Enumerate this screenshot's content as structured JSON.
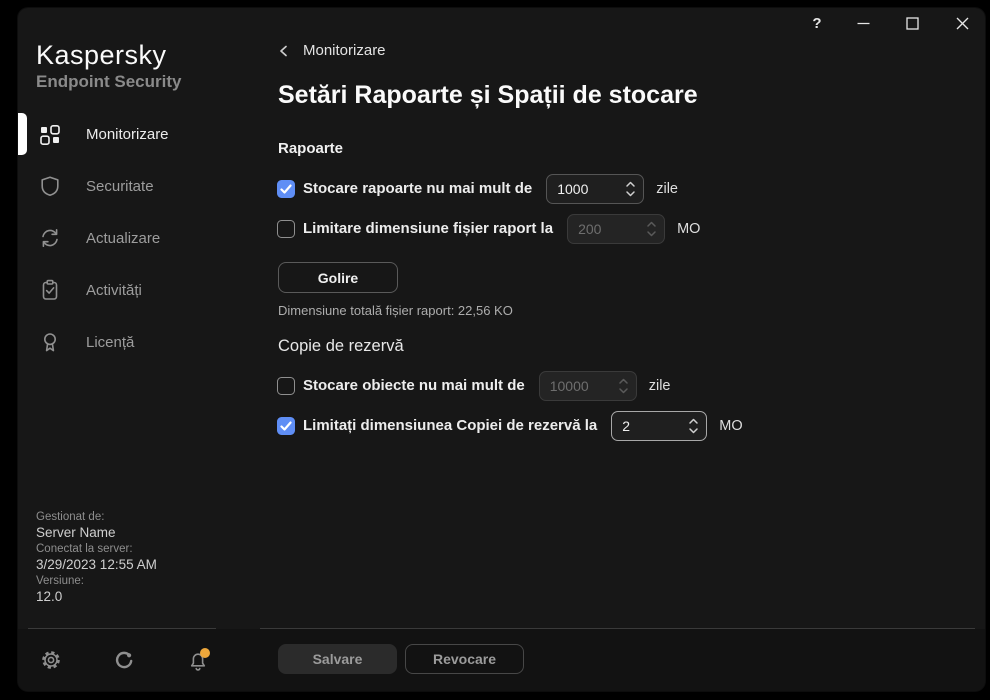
{
  "titlebar": {
    "help_label": "?"
  },
  "brand": {
    "name": "Kaspersky",
    "product": "Endpoint Security"
  },
  "sidebar": {
    "items": [
      {
        "label": "Monitorizare",
        "icon": "dashboard-icon",
        "active": true
      },
      {
        "label": "Securitate",
        "icon": "shield-icon",
        "active": false
      },
      {
        "label": "Actualizare",
        "icon": "refresh-icon",
        "active": false
      },
      {
        "label": "Activități",
        "icon": "clipboard-check-icon",
        "active": false
      },
      {
        "label": "Licență",
        "icon": "license-ribbon-icon",
        "active": false
      }
    ],
    "info": {
      "managed_by_label": "Gestionat de:",
      "managed_by_value": "Server Name",
      "connected_label": "Conectat la server:",
      "connected_value": "3/29/2023 12:55 AM",
      "version_label": "Versiune:",
      "version_value": "12.0"
    }
  },
  "main": {
    "breadcrumb": "Monitorizare",
    "title": "Setări Rapoarte și Spații de stocare",
    "reports": {
      "heading": "Rapoarte",
      "rows": [
        {
          "label": "Stocare rapoarte nu mai mult de",
          "value": "1000",
          "unit": "zile",
          "checked": true,
          "disabled": false
        },
        {
          "label": "Limitare dimensiune fișier raport la",
          "value": "200",
          "unit": "MO",
          "checked": false,
          "disabled": true
        }
      ],
      "clear_button": "Golire",
      "size_note": "Dimensiune totală fișier raport: 22,56 KO"
    },
    "backup": {
      "heading": "Copie de rezervă",
      "rows": [
        {
          "label": "Stocare obiecte nu mai mult de",
          "value": "10000",
          "unit": "zile",
          "checked": false,
          "disabled": true
        },
        {
          "label": "Limitați dimensiunea Copiei de rezervă la",
          "value": "2",
          "unit": "MO",
          "checked": true,
          "disabled": false,
          "focused": true
        }
      ]
    }
  },
  "footer": {
    "save_button": "Salvare",
    "cancel_button": "Revocare"
  },
  "colors": {
    "accent_blue": "#5f8ef5",
    "notification_badge": "#eda73b",
    "window_bg": "#171717",
    "footer_bg": "#121212"
  }
}
